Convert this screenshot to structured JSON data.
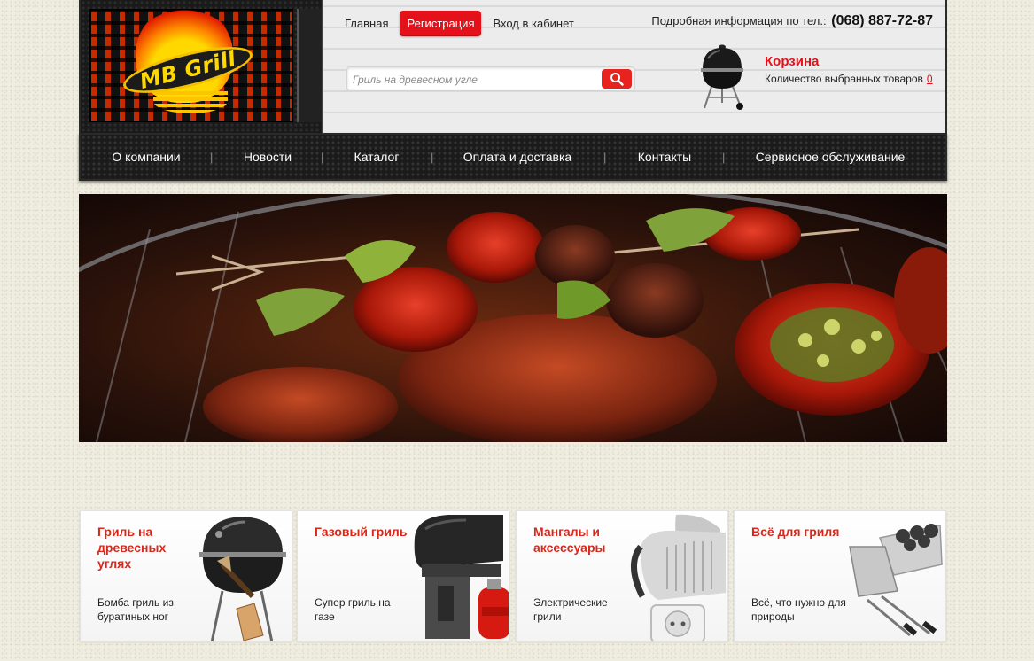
{
  "logo": {
    "text": "MB Grill"
  },
  "topnav": {
    "items": [
      {
        "label": "Главная",
        "active": false
      },
      {
        "label": "Регистрация",
        "active": true
      },
      {
        "label": "Вход в кабинет",
        "active": false
      }
    ]
  },
  "phone": {
    "label": "Подробная информация по тел.:",
    "number": "(068) 887-72-87"
  },
  "search": {
    "placeholder": "Гриль на древесном угле",
    "icon": "search-icon"
  },
  "cart": {
    "title": "Корзина",
    "count_label": "Количество выбранных товаров",
    "count": "0"
  },
  "mainnav": {
    "items": [
      "О компании",
      "Новости",
      "Каталог",
      "Оплата и доставка",
      "Контакты",
      "Сервисное обслуживание"
    ],
    "separator": "|"
  },
  "colors": {
    "accent": "#e4101a",
    "card_title": "#d9281b",
    "nav_bg": "#1b1b1b"
  },
  "cards": [
    {
      "title": "Гриль на древесных углях",
      "desc": "Бомба гриль из буратиных ног"
    },
    {
      "title": "Газовый гриль",
      "desc": "Супер гриль на газе"
    },
    {
      "title": "Мангалы и аксессуары",
      "desc": "Электрические грили"
    },
    {
      "title": "Всё для гриля",
      "desc": "Всё, что нужно для природы"
    }
  ]
}
